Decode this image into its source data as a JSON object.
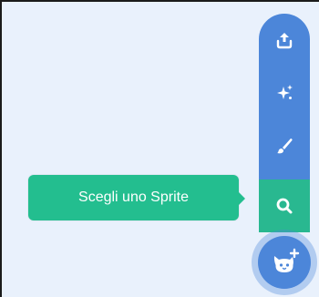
{
  "sprite_menu": {
    "tooltip_label": "Scegli uno Sprite",
    "icons": {
      "upload": "upload-icon",
      "surprise": "sparkle-icon",
      "paint": "paintbrush-icon",
      "search": "search-icon",
      "main": "cat-plus-icon"
    }
  },
  "colors": {
    "menu_blue": "#4c86d9",
    "search_green": "#29b890",
    "tooltip_green": "#23be8f",
    "stage_bg": "#e9f1fc"
  }
}
